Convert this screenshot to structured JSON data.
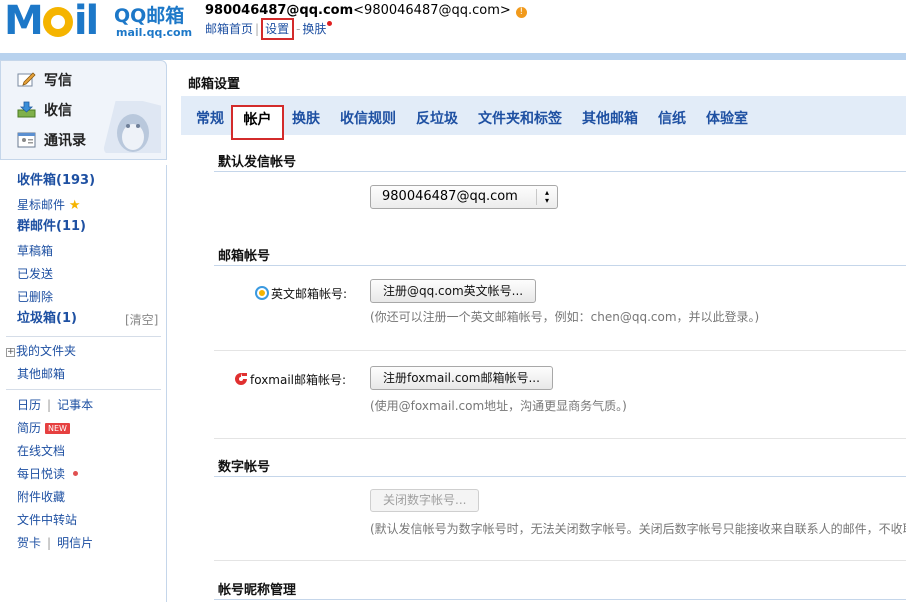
{
  "header": {
    "logo_text": "MOIL",
    "brand": "QQ邮箱",
    "brand_domain": "mail.qq.com",
    "account_name": "980046487@qq.com",
    "account_email": "<980046487@qq.com>",
    "links": {
      "home": "邮箱首页",
      "settings": "设置",
      "skin": "换肤"
    }
  },
  "quick_actions": [
    {
      "label": "写信",
      "icon": "compose-icon"
    },
    {
      "label": "收信",
      "icon": "inbox-download-icon"
    },
    {
      "label": "通讯录",
      "icon": "contacts-icon"
    }
  ],
  "folders": {
    "inbox": "收件箱(193)",
    "starred": "星标邮件",
    "group": "群邮件(11)",
    "drafts": "草稿箱",
    "sent": "已发送",
    "deleted": "已删除",
    "spam": "垃圾箱(1)",
    "spam_clear": "[清空]",
    "my_folders": "我的文件夹",
    "other_mail": "其他邮箱",
    "calendar": "日历",
    "notebook": "记事本",
    "resume": "简历",
    "new_badge": "NEW",
    "online_docs": "在线文档",
    "daily_reading": "每日悦读",
    "attachments": "附件收藏",
    "file_transfer": "文件中转站",
    "greeting_card": "贺卡",
    "postcard": "明信片"
  },
  "main": {
    "title": "邮箱设置",
    "tabs": [
      "常规",
      "帐户",
      "换肤",
      "收信规则",
      "反垃圾",
      "文件夹和标签",
      "其他邮箱",
      "信纸",
      "体验室"
    ],
    "active_tab": "帐户",
    "default_sender": {
      "heading": "默认发信帐号",
      "selected": "980046487@qq.com"
    },
    "mail_accounts": {
      "heading": "邮箱帐号",
      "english_label": "英文邮箱帐号:",
      "english_button": "注册@qq.com英文帐号...",
      "english_hint": "(你还可以注册一个英文邮箱帐号，例如：chen@qq.com，并以此登录。)",
      "foxmail_label": "foxmail邮箱帐号:",
      "foxmail_button": "注册foxmail.com邮箱帐号...",
      "foxmail_hint": "(使用@foxmail.com地址，沟通更显商务气质。)"
    },
    "numeric_account": {
      "heading": "数字帐号",
      "button": "关闭数字帐号...",
      "hint": "(默认发信帐号为数字帐号时，无法关闭数字帐号。关闭后数字帐号只能接收来自联系人的邮件，不收取"
    },
    "nickname": {
      "heading": "帐号昵称管理"
    }
  },
  "colors": {
    "brand_blue": "#1d78c8",
    "link_blue": "#1e50a2",
    "tab_bar": "#e2ecf8",
    "highlight_red": "#d32b2b"
  }
}
